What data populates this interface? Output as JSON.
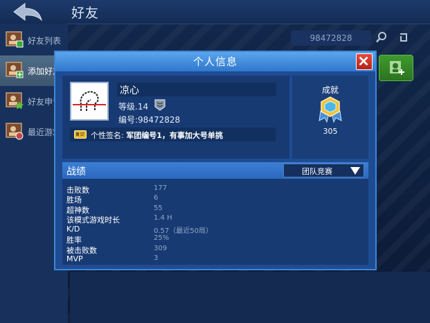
{
  "page": {
    "title": "好友",
    "back_icon": "back-arrow-icon"
  },
  "sidebar": {
    "items": [
      {
        "label": "好友列表",
        "icon": "friends-list-icon"
      },
      {
        "label": "添加好友",
        "icon": "add-friend-icon"
      },
      {
        "label": "好友申请",
        "icon": "friend-request-icon"
      },
      {
        "label": "最近游戏",
        "icon": "recent-games-icon"
      }
    ]
  },
  "search": {
    "value": "98472828",
    "icon": "search-icon",
    "refresh_icon": "refresh-icon",
    "add_icon": "add-user-icon"
  },
  "dialog": {
    "title": "个人信息",
    "close_icon": "close-icon",
    "profile": {
      "name": "凉心",
      "level": "等级.14",
      "id": "编号:98472828",
      "signature_label": "个性签名:",
      "signature_value": "军团编号1，有事加大号单挑",
      "rank_icon": "rank-badge-icon",
      "signature_icon": "id-card-icon"
    },
    "achievement": {
      "title": "成就",
      "count": "305",
      "icon": "achievement-medal-icon"
    },
    "stats": {
      "title": "战绩",
      "mode": "团队竞赛",
      "rows": [
        {
          "label": "击败数",
          "value": "177"
        },
        {
          "label": "胜场",
          "value": "6"
        },
        {
          "label": "超神数",
          "value": "55"
        },
        {
          "label": "该模式游戏时长",
          "value": "1.4 H"
        },
        {
          "label": "K/D",
          "value": "0.57（最近50局）"
        },
        {
          "label": "胜率",
          "value": "25%"
        },
        {
          "label": "被击败数",
          "value": "309"
        },
        {
          "label": "MVP",
          "value": "3"
        }
      ]
    }
  },
  "colors": {
    "background": "#0d1f3e",
    "dialog": "#1e4c93",
    "dialog_header": "#3f8ce0",
    "close_button": "#d0342a",
    "add_button": "#3a8f2a",
    "sidebar_active": "#4a6580"
  }
}
